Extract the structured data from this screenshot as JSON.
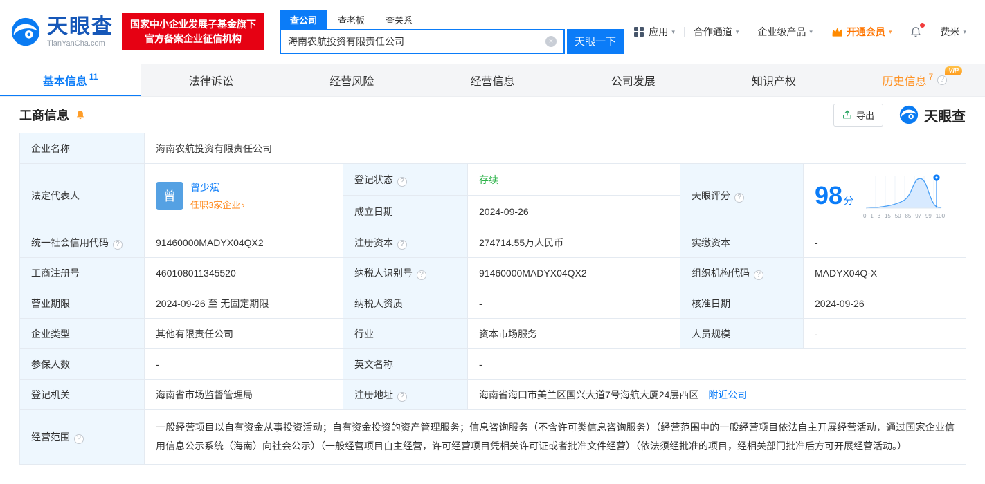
{
  "colors": {
    "primary": "#0b7cf8",
    "status_active_green": "#2db34a",
    "vip_orange": "#ff9325",
    "cert_red": "#e60113",
    "label_cell_bg": "#eef7fe"
  },
  "brand": {
    "name": "天眼查",
    "domain": "TianYanCha.com",
    "cert_line1": "国家中小企业发展子基金旗下",
    "cert_line2": "官方备案企业征信机构"
  },
  "search": {
    "tabs": [
      {
        "label": "查公司"
      },
      {
        "label": "查老板"
      },
      {
        "label": "查关系"
      }
    ],
    "value": "海南农航投资有限责任公司",
    "button": "天眼一下"
  },
  "topnav": {
    "apps": "应用",
    "cooperation": "合作通道",
    "enterprise": "企业级产品",
    "vip": "开通会员",
    "user": "费米"
  },
  "tabs": [
    {
      "label": "基本信息",
      "count": "11"
    },
    {
      "label": "法律诉讼",
      "count": ""
    },
    {
      "label": "经营风险",
      "count": ""
    },
    {
      "label": "经营信息",
      "count": ""
    },
    {
      "label": "公司发展",
      "count": ""
    },
    {
      "label": "知识产权",
      "count": ""
    },
    {
      "label": "历史信息",
      "count": "7",
      "vip": "VIP"
    }
  ],
  "section": {
    "title": "工商信息",
    "export_label": "导出",
    "brand": "天眼查"
  },
  "table": {
    "company_name": {
      "label": "企业名称",
      "value": "海南农航投资有限责任公司"
    },
    "legal_rep": {
      "label": "法定代表人",
      "avatar": "曾",
      "name": "曾少斌",
      "note": "任职3家企业"
    },
    "reg_status": {
      "label": "登记状态",
      "value": "存续"
    },
    "establish_date": {
      "label": "成立日期",
      "value": "2024-09-26"
    },
    "score": {
      "label": "天眼评分",
      "value": "98",
      "unit": "分",
      "axis": [
        "0",
        "1",
        "3",
        "15",
        "50",
        "85",
        "97",
        "99",
        "100"
      ]
    },
    "credit_code": {
      "label": "统一社会信用代码",
      "value": "91460000MADYX04QX2"
    },
    "reg_capital": {
      "label": "注册资本",
      "value": "274714.55万人民币"
    },
    "paid_capital": {
      "label": "实缴资本",
      "value": "-"
    },
    "reg_number": {
      "label": "工商注册号",
      "value": "460108011345520"
    },
    "taxpayer_id": {
      "label": "纳税人识别号",
      "value": "91460000MADYX04QX2"
    },
    "org_code": {
      "label": "组织机构代码",
      "value": "MADYX04Q-X"
    },
    "business_term": {
      "label": "营业期限",
      "value": "2024-09-26 至 无固定期限"
    },
    "taxpayer_quality": {
      "label": "纳税人资质",
      "value": "-"
    },
    "approval_date": {
      "label": "核准日期",
      "value": "2024-09-26"
    },
    "company_type": {
      "label": "企业类型",
      "value": "其他有限责任公司"
    },
    "industry": {
      "label": "行业",
      "value": "资本市场服务"
    },
    "staff_size": {
      "label": "人员规模",
      "value": "-"
    },
    "insured_count": {
      "label": "参保人数",
      "value": "-"
    },
    "english_name": {
      "label": "英文名称",
      "value": "-"
    },
    "reg_authority": {
      "label": "登记机关",
      "value": "海南省市场监督管理局"
    },
    "reg_address": {
      "label": "注册地址",
      "value": "海南省海口市美兰区国兴大道7号海航大厦24层西区",
      "link": "附近公司"
    },
    "business_scope": {
      "label": "经营范围",
      "value": "一般经营项目以自有资金从事投资活动；自有资金投资的资产管理服务；信息咨询服务（不含许可类信息咨询服务）（经营范围中的一般经营项目依法自主开展经营活动，通过国家企业信用信息公示系统（海南）向社会公示）（一般经营项目自主经营，许可经营项目凭相关许可证或者批准文件经营）（依法须经批准的项目，经相关部门批准后方可开展经营活动。）"
    }
  },
  "icons": {
    "help": "?",
    "caret": "▾",
    "clear": "×",
    "arrow": "›"
  }
}
